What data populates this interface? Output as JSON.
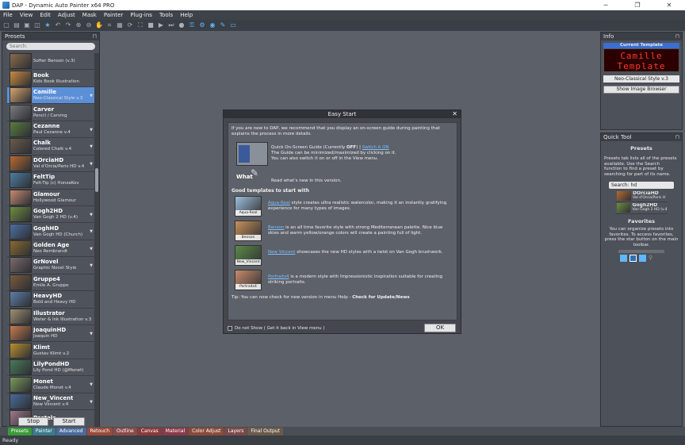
{
  "window": {
    "title": "DAP - Dynamic Auto Painter x64 PRO",
    "min": "─",
    "max": "❐",
    "close": "✕"
  },
  "menu": [
    "File",
    "View",
    "Edit",
    "Adjust",
    "Mask",
    "Painter",
    "Plug-ins",
    "Tools",
    "Help"
  ],
  "presets_panel": {
    "title": "Presets",
    "search_placeholder": "Search:",
    "stop": "Stop",
    "start": "Start",
    "items": [
      {
        "name": "",
        "sub": "Softer Benson (v.3)",
        "color": "#8a6b4a"
      },
      {
        "name": "Book",
        "sub": "Kids Book Illustration",
        "color": "#c98b3e"
      },
      {
        "name": "Camille",
        "sub": "Neo-Classical Style v.3",
        "color": "#d6a46b",
        "selected": true,
        "arrow": true
      },
      {
        "name": "Carver",
        "sub": "Pencil / Carving",
        "color": "#7b7b7b"
      },
      {
        "name": "Cezanne",
        "sub": "Paul Cezanne v.4",
        "color": "#5a7c3f",
        "arrow": true
      },
      {
        "name": "Chalk",
        "sub": "Colored Chalk v.4",
        "color": "#6a5a4a",
        "arrow": true
      },
      {
        "name": "DOrciaHD",
        "sub": "Val d'Orcia/Paris HD v.4",
        "color": "#b86a2d",
        "arrow": true
      },
      {
        "name": "FeltTip",
        "sub": "Felt-Tip (c) HonzaKov",
        "color": "#4c7fa0"
      },
      {
        "name": "Glamour",
        "sub": "Hollywood Glamour",
        "color": "#c48a6e"
      },
      {
        "name": "Gogh2HD",
        "sub": "Van Gogh 2 HD (v.4)",
        "color": "#6e8f3d",
        "arrow": true
      },
      {
        "name": "GoghHD",
        "sub": "Van Gogh HD (Church)",
        "color": "#4e6fa3",
        "arrow": true
      },
      {
        "name": "Golden Age",
        "sub": "Neo Rembrandt",
        "color": "#8a6a2e",
        "arrow": true
      },
      {
        "name": "GrNovel",
        "sub": "Graphic Novel Style",
        "color": "#7a6a6a",
        "arrow": true
      },
      {
        "name": "Gruppe4",
        "sub": "Emile A. Gruppe",
        "color": "#7a5a3a"
      },
      {
        "name": "HeavyHD",
        "sub": "Bold and Heavy HD",
        "color": "#5e7ea6"
      },
      {
        "name": "Illustrator",
        "sub": "Water & Ink Illustration v.3",
        "color": "#a09070"
      },
      {
        "name": "JoaquinHD",
        "sub": "Joaquin HD",
        "color": "#c87a4a",
        "arrow": true
      },
      {
        "name": "Klimt",
        "sub": "Gustav Klimt v.2",
        "color": "#b8902e"
      },
      {
        "name": "LilyPondHD",
        "sub": "Lily Pond HD (@Monet)",
        "color": "#4a7a5a"
      },
      {
        "name": "Monet",
        "sub": "Claude Monet v.4",
        "color": "#7a9a5a",
        "arrow": true
      },
      {
        "name": "New_Vincent",
        "sub": "New Vincent v.4",
        "color": "#4a6a9a",
        "arrow": true
      },
      {
        "name": "Pastels",
        "sub": "",
        "color": "#a07a8a"
      }
    ]
  },
  "dialog": {
    "title": "Easy Start",
    "close": "✕",
    "intro": "If you are new to DAP, we recommend that you display an on-screen guide during painting that explains the process in more details.",
    "guide_line1_a": "Quick On-Screen Guide (Currently ",
    "guide_off": "OFF",
    "guide_line1_b": ") | ",
    "switch_link": "Switch it ON",
    "guide_line2": "The Guide can be minimized/maximized by clicking on it.",
    "guide_line3": "You can also switch it on or off in the View menu.",
    "whats_label": "What",
    "whats_new": "Read what's new in this version.",
    "good_heading": "Good templates to start with",
    "templates": [
      {
        "label": "Aqua-Real",
        "link": "Aqua-Real",
        "desc": " style creates ultra realistic watercolor, making it an instantly gratifying experience for many types of images.",
        "color": "#9cc0dc"
      },
      {
        "label": "Benson",
        "link": "Benson",
        "desc": " is an all time favorite style with strong Mediterranean palette. Nice blue skies and warm yellow/orange colors will create a painting full of light.",
        "color": "#c8905a"
      },
      {
        "label": "New_Vincent",
        "link": "New Vincent",
        "desc": " showcases the new HD styles with a twist on Van Gogh brushwork.",
        "color": "#5a8a4a"
      },
      {
        "label": "Portraits4",
        "link": "Portraits4",
        "desc": " is a modern style with Impressionistic inspiration suitable for creating striking portraits.",
        "color": "#c88a6a"
      }
    ],
    "tip_a": "Tip: You can now check for new version in menu Help - ",
    "tip_b": "Check for Update/News",
    "dont_show": "Do not Show  ( Get it back in View menu )",
    "ok": "OK"
  },
  "info_panel": {
    "title": "Info",
    "current_template": "Current Template",
    "led": "Camille Template",
    "style": "Neo-Classical Style v.3",
    "show_browser": "Show Image Browser"
  },
  "quick_tool": {
    "title": "Quick Tool",
    "presets_heading": "Presets",
    "presets_text": "Presets tab lists all of the presets available. Use the Search function to find a preset by searching for part of its name.",
    "search_label": "Search:",
    "search_value": "hd",
    "results": [
      {
        "name": "DOrciaHD",
        "sub": "Val d'Orcia/Paris H",
        "color": "#b86a2d"
      },
      {
        "name": "Gogh2HD",
        "sub": "Van Gogh 2 HD (v.4)",
        "color": "#6e8f3d"
      }
    ],
    "favorites_heading": "Favorites",
    "favorites_text": "You can organize presets into favorites. To access favorites, press the star button on the main toolbar."
  },
  "tabs": [
    {
      "label": "Presets",
      "color": "#3a9a3a"
    },
    {
      "label": "Painter",
      "color": "#3a7a8a"
    },
    {
      "label": "Advanced",
      "color": "#4a6a9a"
    },
    {
      "label": "Retouch",
      "color": "#9a4a3a"
    },
    {
      "label": "Outline",
      "color": "#8a4a4a"
    },
    {
      "label": "Canvas",
      "color": "#8a3a3a"
    },
    {
      "label": "Material",
      "color": "#8a3a4a"
    },
    {
      "label": "Color Adjust",
      "color": "#8a4a3a"
    },
    {
      "label": "Layers",
      "color": "#7a4a4a"
    },
    {
      "label": "Final Output",
      "color": "#6a5a4a"
    }
  ],
  "status": "Ready"
}
